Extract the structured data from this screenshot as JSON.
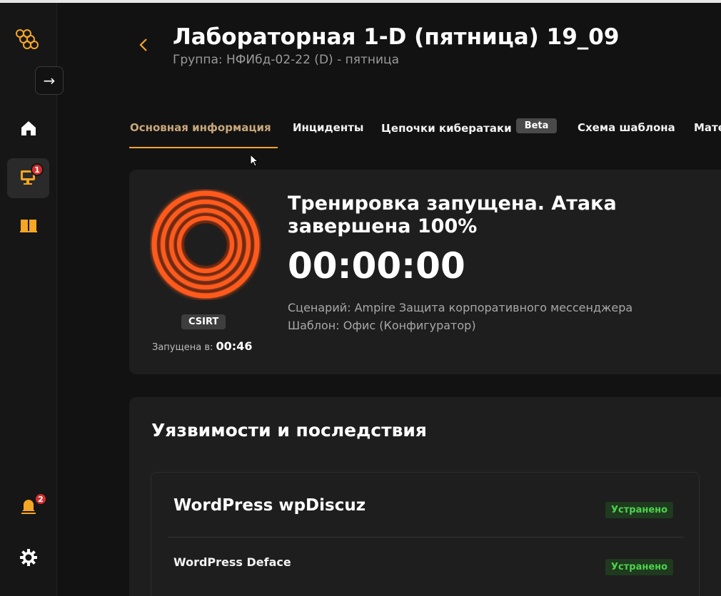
{
  "sidebar": {
    "expand_icon": "arrow-right-icon",
    "items": [
      {
        "name": "home",
        "icon": "home-icon"
      },
      {
        "name": "trainings",
        "icon": "monitor-icon",
        "badge": "1"
      },
      {
        "name": "library",
        "icon": "book-icon"
      }
    ],
    "notifications": {
      "icon": "bell-icon",
      "badge": "2"
    },
    "settings": {
      "icon": "gear-icon"
    }
  },
  "header": {
    "title": "Лабораторная 1-D (пятница) 19_09",
    "subtitle": "Группа: НФИбд-02-22 (D) - пятница"
  },
  "tabs": [
    {
      "label": "Основная информация",
      "active": true
    },
    {
      "label": "Инциденты"
    },
    {
      "label": "Цепочки кибератаки",
      "badge": "Beta"
    },
    {
      "label": "Схема шаблона"
    },
    {
      "label": "Мате"
    }
  ],
  "status": {
    "text": "Тренировка запущена. Атака завершена 100%",
    "progress_percent": 100,
    "timer": "00:00:00",
    "team_badge": "CSIRT",
    "started_label": "Запущена в:",
    "started_time": "00:46",
    "scenario": "Сценарий: Ampire Защита корпоративного мессенджера",
    "template": "Шаблон: Офис (Конфигуратор)"
  },
  "vulnerabilities": {
    "title": "Уязвимости и последствия",
    "items": [
      {
        "name": "WordPress wpDiscuz",
        "status": "Устранено"
      },
      {
        "name": "WordPress Deface",
        "status": "Устранено"
      }
    ]
  },
  "colors": {
    "accent": "#f5a623",
    "spiral": "#ff5a1f",
    "badge_red": "#d32f2f",
    "success": "#4cd34c"
  }
}
